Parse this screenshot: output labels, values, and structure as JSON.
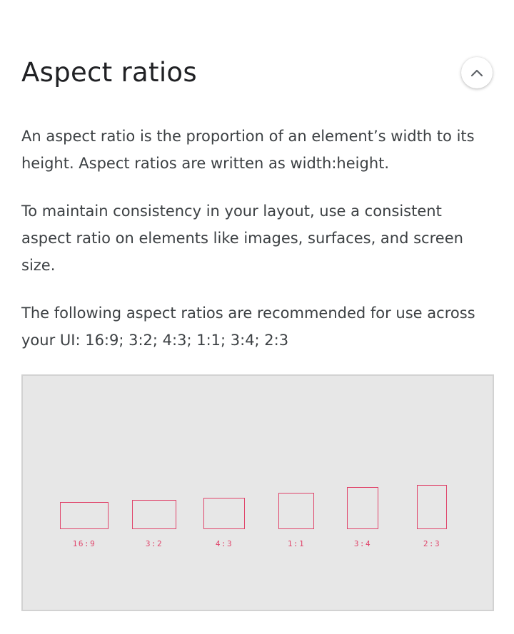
{
  "header": {
    "title": "Aspect ratios",
    "collapse_icon": "chevron-up-icon"
  },
  "content": {
    "paragraphs": [
      "An aspect ratio is the proportion of an element’s width to its height. Aspect ratios are written as width:height.",
      "To maintain consistency in your layout, use a consistent aspect ratio on elements like images, surfaces, and screen size.",
      "The following aspect ratios are recommended for use across your UI: 16:9; 3:2; 4:3; 1:1; 3:4; 2:3"
    ]
  },
  "figure": {
    "ratios": [
      {
        "label": "16:9",
        "w": 16,
        "h": 9
      },
      {
        "label": "3:2",
        "w": 3,
        "h": 2
      },
      {
        "label": "4:3",
        "w": 4,
        "h": 3
      },
      {
        "label": "1:1",
        "w": 1,
        "h": 1
      },
      {
        "label": "3:4",
        "w": 3,
        "h": 4
      },
      {
        "label": "2:3",
        "w": 2,
        "h": 3
      }
    ],
    "colors": {
      "accent": "#e0456b",
      "panel_background": "#e7e7e7",
      "panel_border": "#d2d2d2"
    }
  }
}
